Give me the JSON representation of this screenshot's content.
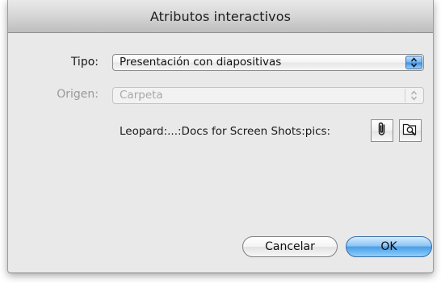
{
  "window": {
    "title": "Atributos interactivos"
  },
  "form": {
    "tipo_label": "Tipo:",
    "tipo_value": "Presentación con diapositivas",
    "origen_label": "Origen:",
    "origen_value": "Carpeta",
    "origen_enabled": false,
    "path": "Leopard:...:Docs for Screen Shots:pics:"
  },
  "icons": {
    "attach": "paperclip-icon",
    "browse": "magnifier-folder-icon",
    "popup_arrows": "up-down-chevron-icon"
  },
  "buttons": {
    "cancel_label": "Cancelar",
    "ok_label": "OK"
  },
  "colors": {
    "window_bg": "#e9e9e9",
    "default_button": "#4a9de6",
    "disabled_text": "#9a9a9a"
  }
}
